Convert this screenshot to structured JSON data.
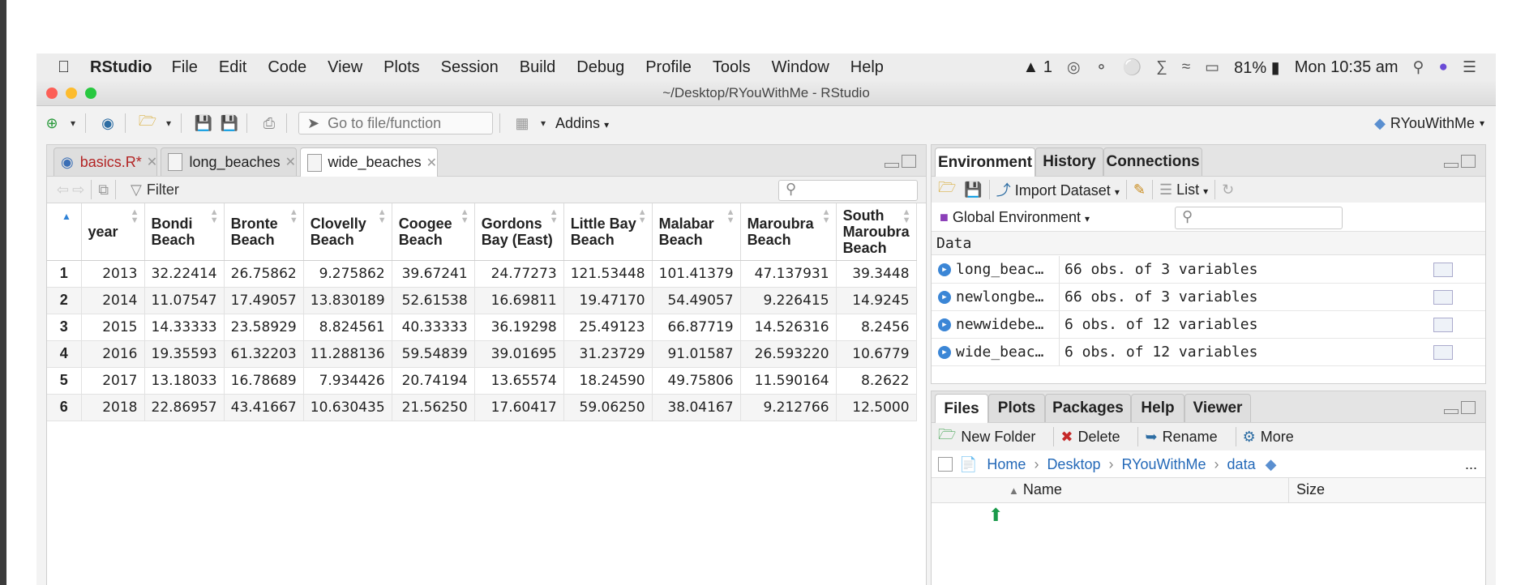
{
  "menubar": {
    "app_name": "RStudio",
    "items": [
      "File",
      "Edit",
      "Code",
      "View",
      "Plots",
      "Session",
      "Build",
      "Debug",
      "Profile",
      "Tools",
      "Window",
      "Help"
    ],
    "status_count": "1",
    "battery": "81%",
    "clock": "Mon 10:35 am"
  },
  "window": {
    "title": "~/Desktop/RYouWithMe - RStudio"
  },
  "toolbar": {
    "goto_placeholder": "Go to file/function",
    "addins_label": "Addins",
    "project_name": "RYouWithMe"
  },
  "editor": {
    "tabs": [
      {
        "label": "basics.R*",
        "active": false
      },
      {
        "label": "long_beaches",
        "active": false
      },
      {
        "label": "wide_beaches",
        "active": true
      }
    ],
    "filter_label": "Filter"
  },
  "table": {
    "columns": [
      "year",
      "Bondi Beach",
      "Bronte Beach",
      "Clovelly Beach",
      "Coogee Beach",
      "Gordons Bay (East)",
      "Little Bay Beach",
      "Malabar Beach",
      "Maroubra Beach",
      "South Maroubra Beach"
    ],
    "rows": [
      [
        "1",
        "2013",
        "32.22414",
        "26.75862",
        "9.275862",
        "39.67241",
        "24.77273",
        "121.53448",
        "101.41379",
        "47.137931",
        "39.3448"
      ],
      [
        "2",
        "2014",
        "11.07547",
        "17.49057",
        "13.830189",
        "52.61538",
        "16.69811",
        "19.47170",
        "54.49057",
        "9.226415",
        "14.9245"
      ],
      [
        "3",
        "2015",
        "14.33333",
        "23.58929",
        "8.824561",
        "40.33333",
        "36.19298",
        "25.49123",
        "66.87719",
        "14.526316",
        "8.2456"
      ],
      [
        "4",
        "2016",
        "19.35593",
        "61.32203",
        "11.288136",
        "59.54839",
        "39.01695",
        "31.23729",
        "91.01587",
        "26.593220",
        "10.6779"
      ],
      [
        "5",
        "2017",
        "13.18033",
        "16.78689",
        "7.934426",
        "20.74194",
        "13.65574",
        "18.24590",
        "49.75806",
        "11.590164",
        "8.2622"
      ],
      [
        "6",
        "2018",
        "22.86957",
        "43.41667",
        "10.630435",
        "21.56250",
        "17.60417",
        "59.06250",
        "38.04167",
        "9.212766",
        "12.5000"
      ]
    ]
  },
  "env": {
    "tabs": [
      "Environment",
      "History",
      "Connections"
    ],
    "import_label": "Import Dataset",
    "list_label": "List",
    "scope_label": "Global Environment",
    "data_header": "Data",
    "items": [
      {
        "name": "long_beac…",
        "value": "66 obs. of 3 variables"
      },
      {
        "name": "newlongbe…",
        "value": "66 obs. of 3 variables"
      },
      {
        "name": "newwidebe…",
        "value": "6 obs. of 12 variables"
      },
      {
        "name": "wide_beac…",
        "value": "6 obs. of 12 variables"
      }
    ]
  },
  "files": {
    "tabs": [
      "Files",
      "Plots",
      "Packages",
      "Help",
      "Viewer"
    ],
    "new_folder": "New Folder",
    "delete": "Delete",
    "rename": "Rename",
    "more": "More",
    "breadcrumb": [
      "Home",
      "Desktop",
      "RYouWithMe",
      "data"
    ],
    "ellipsis": "...",
    "name_col": "Name",
    "size_col": "Size"
  }
}
